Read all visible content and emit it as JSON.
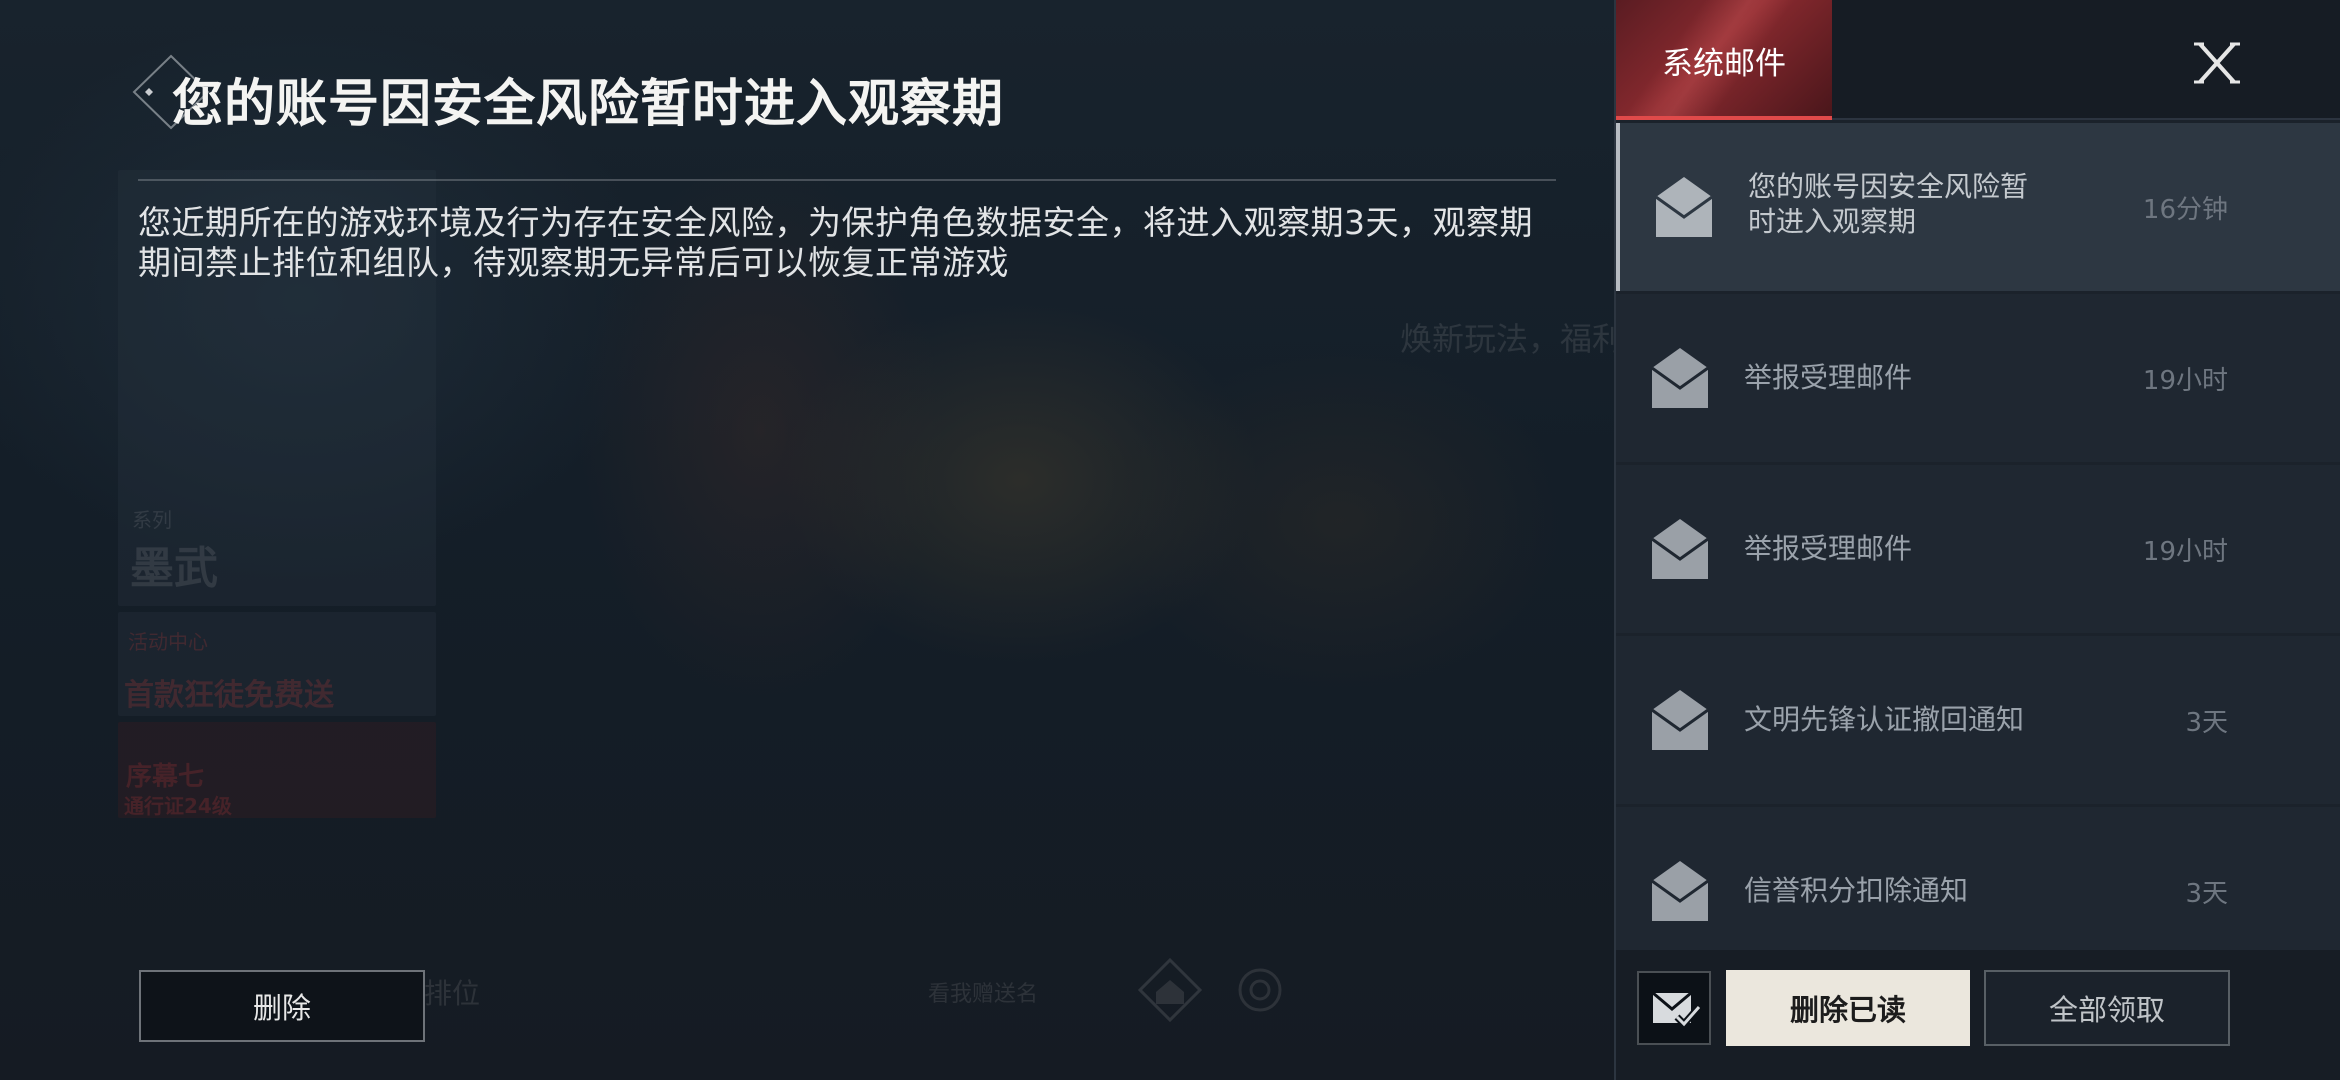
{
  "background": {
    "ghost_texts": [
      "系列",
      "墨武",
      "活动中心",
      "首款狂徒免费送",
      "序幕七",
      "通行证24级",
      "焕新玩法，福利",
      "排位",
      "看我赠送名"
    ]
  },
  "detail": {
    "title": "您的账号因安全风险暂时进入观察期",
    "body": "您近期所在的游戏环境及行为存在安全风险，为保护角色数据安全，将进入观察期3天，观察期期间禁止排位和组队，待观察期无异常后可以恢复正常游戏",
    "delete_label": "删除"
  },
  "panel": {
    "tab_label": "系统邮件",
    "mails": [
      {
        "title": "您的账号因安全风险暂时进入观察期",
        "time": "16分钟",
        "selected": true
      },
      {
        "title": "举报受理邮件",
        "time": "19小时",
        "selected": false
      },
      {
        "title": "举报受理邮件",
        "time": "19小时",
        "selected": false
      },
      {
        "title": "文明先锋认证撤回通知",
        "time": "3天",
        "selected": false
      },
      {
        "title": "信誉积分扣除通知",
        "time": "3天",
        "selected": false
      }
    ],
    "footer": {
      "delete_read_label": "删除已读",
      "claim_all_label": "全部领取"
    }
  },
  "colors": {
    "accent_red": "#e04a4a",
    "primary_button": "#ebe7dd",
    "panel_bg": "#1b222b"
  }
}
